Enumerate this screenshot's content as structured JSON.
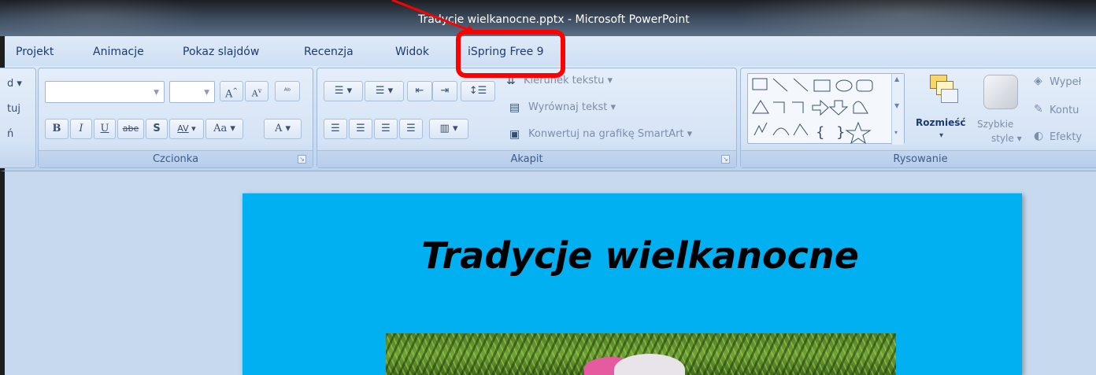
{
  "window": {
    "title": "Tradycje wielkanocne.pptx - Microsoft PowerPoint"
  },
  "tabs": [
    {
      "label": "Projekt"
    },
    {
      "label": "Animacje"
    },
    {
      "label": "Pokaz slajdów"
    },
    {
      "label": "Recenzja"
    },
    {
      "label": "Widok"
    },
    {
      "label": "iSpring Free 9"
    }
  ],
  "ribbon": {
    "left_partial": {
      "item1": "d ▾",
      "item2": "tuj",
      "item3": "ń"
    },
    "font_group": {
      "label": "Czcionka",
      "bold": "B",
      "italic": "I",
      "underline": "U",
      "strike": "abe",
      "shadow": "S",
      "spacing": "AV",
      "case": "Aa",
      "color": "A",
      "grow": "A",
      "shrink": "A"
    },
    "paragraph_group": {
      "label": "Akapit",
      "text_direction": "Kierunek tekstu",
      "align_text": "Wyrównaj tekst",
      "convert_smartart": "Konwertuj na grafikę SmartArt"
    },
    "drawing_group": {
      "label": "Rysowanie",
      "arrange": "Rozmieść",
      "quick_styles_1": "Szybkie",
      "quick_styles_2": "style",
      "fill": "Wypeł",
      "outline": "Kontu",
      "effects": "Efekty"
    }
  },
  "slide": {
    "title": "Tradycje wielkanocne"
  },
  "annotation": {
    "highlight_color": "#ff0000"
  }
}
